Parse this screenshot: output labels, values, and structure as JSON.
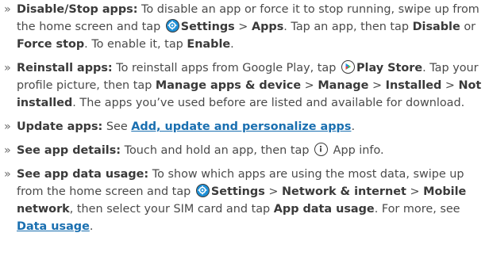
{
  "items": [
    {
      "heading": "Disable/Stop apps:",
      "t1": " To disable an app or force it to stop running, swipe up from the home screen and tap ",
      "settings": "Settings",
      "sep1": " > ",
      "apps": "Apps",
      "t2": ". Tap an app, then tap ",
      "disable": "Disable",
      "t3": " or ",
      "force": "Force stop",
      "t4": ". To enable it, tap ",
      "enable": "Enable",
      "t5": "."
    },
    {
      "heading": "Reinstall apps:",
      "t1": " To reinstall apps from Google Play, tap ",
      "store": "Play Store",
      "t2": ". Tap your profile picture, then tap ",
      "manage_device": "Manage apps & device",
      "sep1": " > ",
      "manage": "Manage",
      "sep2": " > ",
      "installed": "Installed",
      "sep3": " > ",
      "not_installed": "Not installed",
      "t3": ". The apps you’ve used before are listed and available for download."
    },
    {
      "heading": "Update apps:",
      "t1": " See ",
      "link": "Add, update and personalize apps",
      "t2": "."
    },
    {
      "heading": "See app details:",
      "t1": " Touch and hold an app, then tap ",
      "t2": " App info."
    },
    {
      "heading": "See app data usage:",
      "t1": " To show which apps are using the most data, swipe up from the home screen and tap ",
      "settings": "Settings",
      "sep1": " > ",
      "network": "Network & internet",
      "sep2": " > ",
      "mobile": "Mobile network",
      "t2": ", then select your SIM card and tap ",
      "app_data": "App data usage",
      "t3": ". For more, see ",
      "link": "Data usage",
      "t4": "."
    }
  ],
  "bullet": "»",
  "colors": {
    "text": "#4a4a4a",
    "link": "#1a6fb0",
    "settings_icon": "#1d8fd6"
  },
  "icons": [
    "settings-icon",
    "play-store-icon",
    "info-icon"
  ]
}
